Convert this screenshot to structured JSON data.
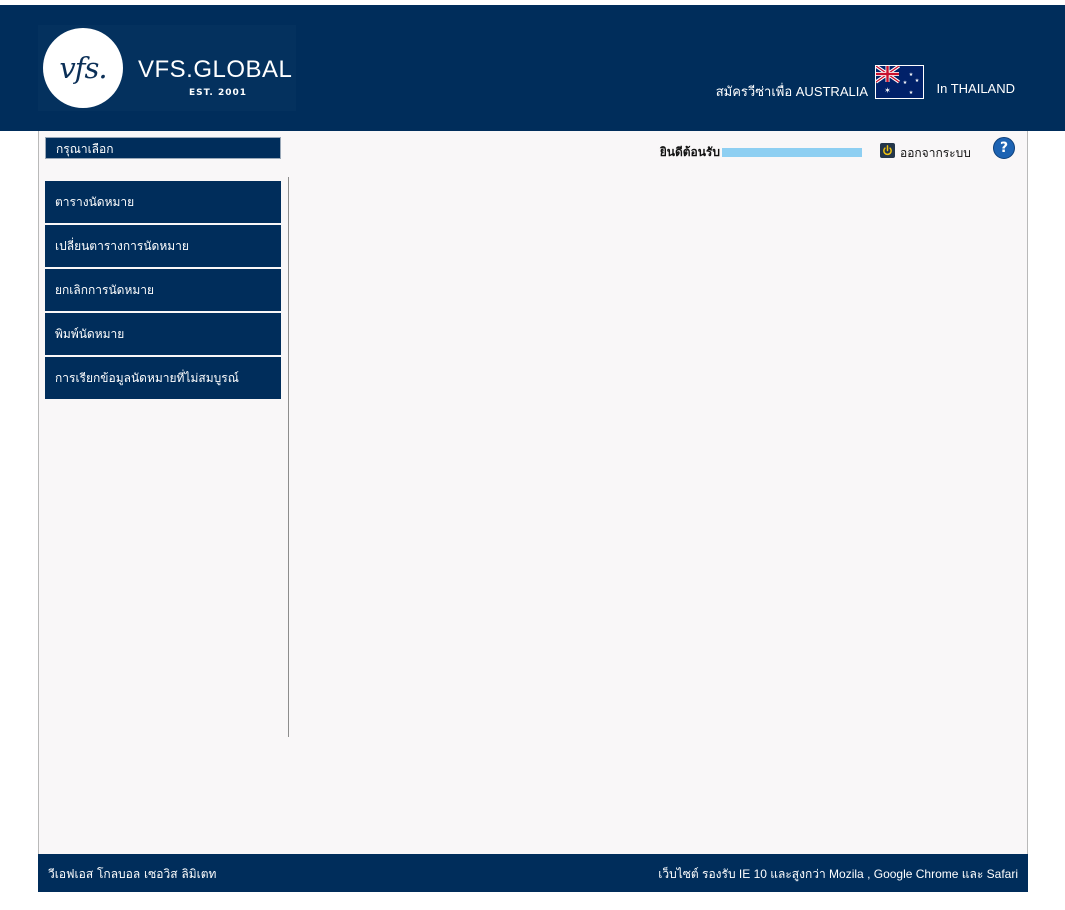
{
  "header": {
    "logo_mark": "vfs.",
    "logo_name": "VFS.GLOBAL",
    "logo_est": "EST. 2001",
    "apply_text": "สมัครวีซ่าเพื่อ AUSTRALIA",
    "country_text": "In THAILAND",
    "flag_icon": "australia-flag-icon"
  },
  "toolbar": {
    "select_label": "กรุณาเลือก",
    "welcome_text": "ยินดีต้อนรับ",
    "logout_label": "ออกจากระบบ",
    "help_label": "?"
  },
  "menu": {
    "items": [
      {
        "label": "ตารางนัดหมาย"
      },
      {
        "label": "เปลี่ยนตารางการนัดหมาย"
      },
      {
        "label": "ยกเลิกการนัดหมาย"
      },
      {
        "label": "พิมพ์นัดหมาย"
      },
      {
        "label": "การเรียกข้อมูลนัดหมายที่ไม่สมบูรณ์"
      }
    ]
  },
  "footer": {
    "left_text": "วีเอฟเอส โกลบอล เซอวิส ลิมิเตท",
    "right_text": "เว็บไซต์ รองรับ IE 10 และสูงกว่า Mozila , Google Chrome และ Safari"
  },
  "colors": {
    "navy": "#002d5b",
    "content_bg": "#f9f7f8",
    "redaction": "#8ecff2",
    "help_blue": "#1d63b3"
  }
}
